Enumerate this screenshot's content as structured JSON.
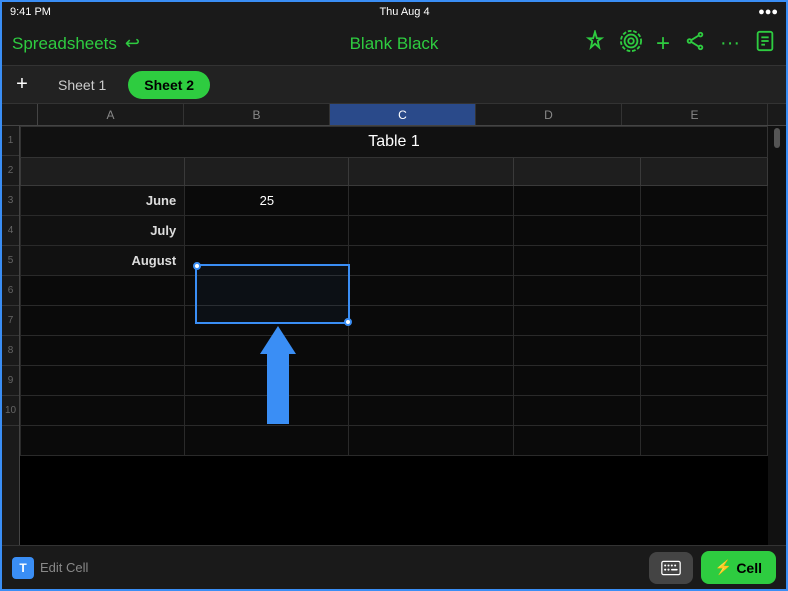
{
  "statusBar": {
    "time": "9:41 PM",
    "date": "Thu Aug 4"
  },
  "toolbar": {
    "appName": "Spreadsheets",
    "docTitle": "Blank Black",
    "backIcon": "↩",
    "icons": [
      "pin-icon",
      "layers-icon",
      "add-icon",
      "share-icon",
      "more-icon",
      "doc-icon"
    ]
  },
  "tabs": {
    "addLabel": "+",
    "sheets": [
      {
        "label": "Sheet 1",
        "active": false
      },
      {
        "label": "Sheet 2",
        "active": true
      }
    ]
  },
  "columnHeaders": [
    "A",
    "B",
    "C",
    "D",
    "E"
  ],
  "rowNumbers": [
    "1",
    "2",
    "3",
    "4",
    "5",
    "6",
    "7",
    "8",
    "9",
    "10"
  ],
  "table": {
    "title": "Table 1",
    "headers": [
      "",
      "",
      ""
    ],
    "rows": [
      {
        "label": "June",
        "col1": "25",
        "col2": ""
      },
      {
        "label": "July",
        "col1": "",
        "col2": ""
      },
      {
        "label": "August",
        "col1": "",
        "col2": ""
      },
      {
        "label": "",
        "col1": "",
        "col2": ""
      },
      {
        "label": "",
        "col1": "",
        "col2": ""
      },
      {
        "label": "",
        "col1": "",
        "col2": ""
      },
      {
        "label": "",
        "col1": "",
        "col2": ""
      },
      {
        "label": "",
        "col1": "",
        "col2": ""
      },
      {
        "label": "",
        "col1": "",
        "col2": ""
      }
    ]
  },
  "bottomBar": {
    "tLabel": "T",
    "editLabel": "Edit Cell",
    "keyboardLabel": "⌨",
    "cellLabel": "Cell",
    "lightningLabel": "⚡"
  },
  "colors": {
    "accent": "#2ecc40",
    "blue": "#3a8ef5",
    "background": "#000000",
    "surface": "#111111",
    "border": "#2a2a2a"
  }
}
